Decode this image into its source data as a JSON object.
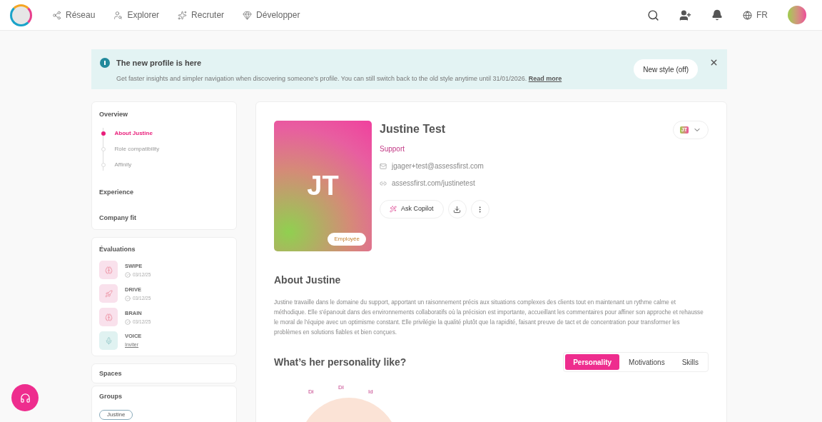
{
  "nav": {
    "items": [
      {
        "label": "Réseau"
      },
      {
        "label": "Explorer"
      },
      {
        "label": "Recruter"
      },
      {
        "label": "Développer"
      }
    ],
    "language": "FR"
  },
  "banner": {
    "title": "The new profile is here",
    "text": "Get faster insights and simpler navigation when discovering someone’s profile. You can still switch back to the old style anytime until 31/01/2026.",
    "link": "Read more",
    "button": "New style (off)"
  },
  "sidebar": {
    "overview": {
      "title": "Overview",
      "steps": [
        {
          "label": "About Justine",
          "selected": true
        },
        {
          "label": "Role compatibility",
          "selected": false
        },
        {
          "label": "Affinity",
          "selected": false
        }
      ]
    },
    "sections": [
      "Experience",
      "Company fit"
    ],
    "evaluations": {
      "title": "Évaluations",
      "items": [
        {
          "name": "SWIPE",
          "kind": "done",
          "detail": "03/12/25",
          "color": "#f9e1ec"
        },
        {
          "name": "DRIVE",
          "kind": "done",
          "detail": "03/12/25",
          "color": "#f9e1ec"
        },
        {
          "name": "BRAIN",
          "kind": "done",
          "detail": "03/12/25",
          "color": "#f9e1ec"
        },
        {
          "name": "VOICE",
          "kind": "invite",
          "detail": "Inviter",
          "color": "#e0f2f1"
        }
      ]
    },
    "spaces": "Spaces",
    "groups": {
      "title": "Groups",
      "tags": [
        "Justine"
      ]
    }
  },
  "profile": {
    "initials": "JT",
    "status": "Employée",
    "name": "Justine Test",
    "role": "Support",
    "email": "jgager+test@assessfirst.com",
    "url": "assessfirst.com/justinetest",
    "copilot": "Ask Copilot",
    "badge": "JT"
  },
  "about": {
    "title": "About Justine",
    "text": "Justine travaille dans le domaine du support, apportant un raisonnement précis aux situations complexes des clients tout en maintenant un rythme calme et méthodique. Elle s'épanouit dans des environnements collaboratifs où la précision est importante, accueillant les commentaires pour affiner son approche et rehausse le moral de l'équipe avec un optimisme constant. Elle privilégie la qualité plutôt que la rapidité, faisant preuve de tact et de concentration pour transformer les problèmes en solutions fiables et bien conçues."
  },
  "personality": {
    "title": "What’s her personality like?",
    "tabs": [
      {
        "label": "Personality",
        "selected": true
      },
      {
        "label": "Motivations",
        "selected": false
      },
      {
        "label": "Skills",
        "selected": false
      }
    ],
    "wheel_labels": [
      "Di",
      "DI",
      "Id"
    ]
  }
}
